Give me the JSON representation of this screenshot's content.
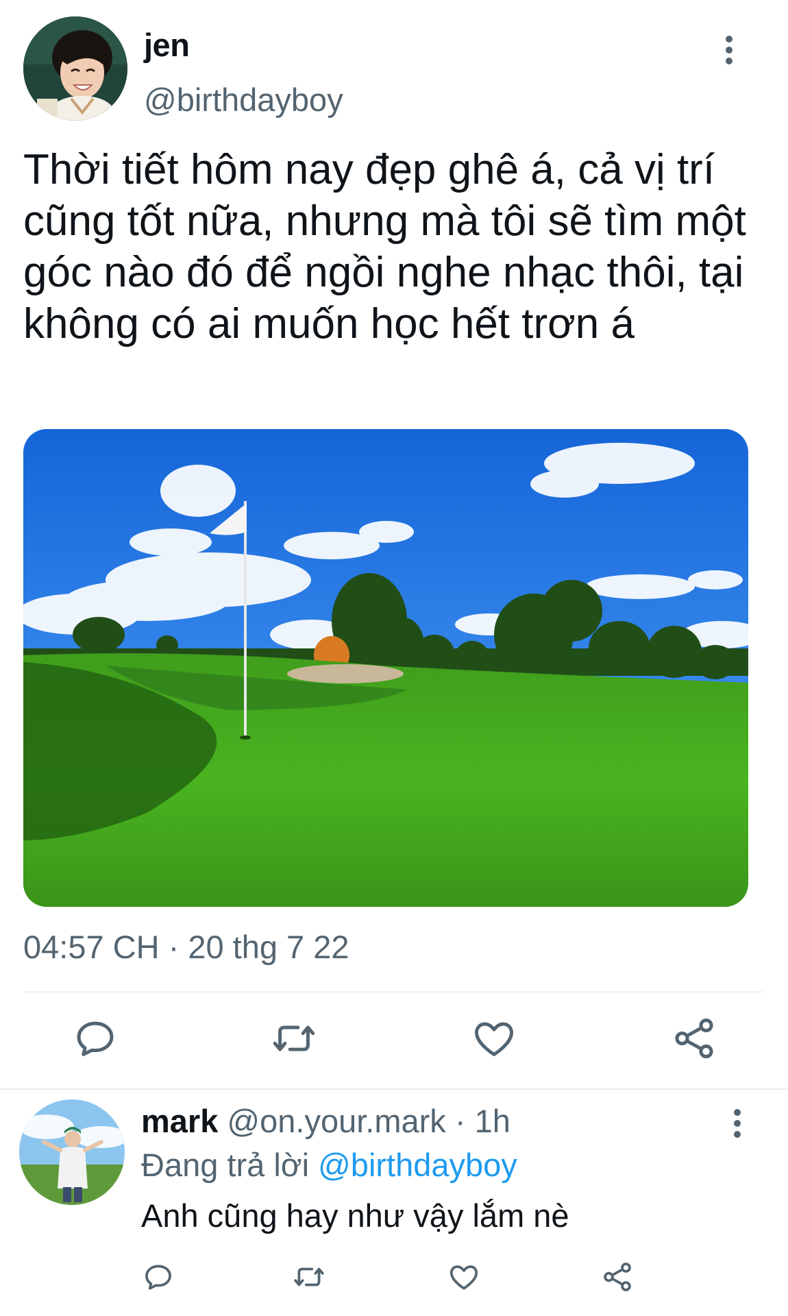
{
  "tweet": {
    "author": {
      "name": "jen",
      "handle": "@birthdayboy"
    },
    "text": "Thời tiết hôm nay đẹp ghê á, cả vị trí cũng tốt nữa, nhưng mà tôi sẽ tìm một góc nào đó để ngồi nghe nhạc thôi, tại không có ai muốn học hết trơn á",
    "timestamp": "04:57 CH · 20 thg 7 22",
    "actions": [
      "reply-icon",
      "retweet-icon",
      "like-icon",
      "share-icon"
    ]
  },
  "reply": {
    "author": {
      "name": "mark",
      "handle": "@on.your.mark"
    },
    "separator": "·",
    "time": "1h",
    "replying_prefix": "Đang trả lời",
    "replying_to": "@birthdayboy",
    "text": "Anh cũng hay như vậy lắm nè",
    "actions": [
      "reply-icon",
      "retweet-icon",
      "like-icon",
      "share-icon"
    ]
  },
  "colors": {
    "text_primary": "#0f1419",
    "text_secondary": "#536471",
    "accent": "#1d9bf0",
    "divider": "#eff3f4"
  }
}
